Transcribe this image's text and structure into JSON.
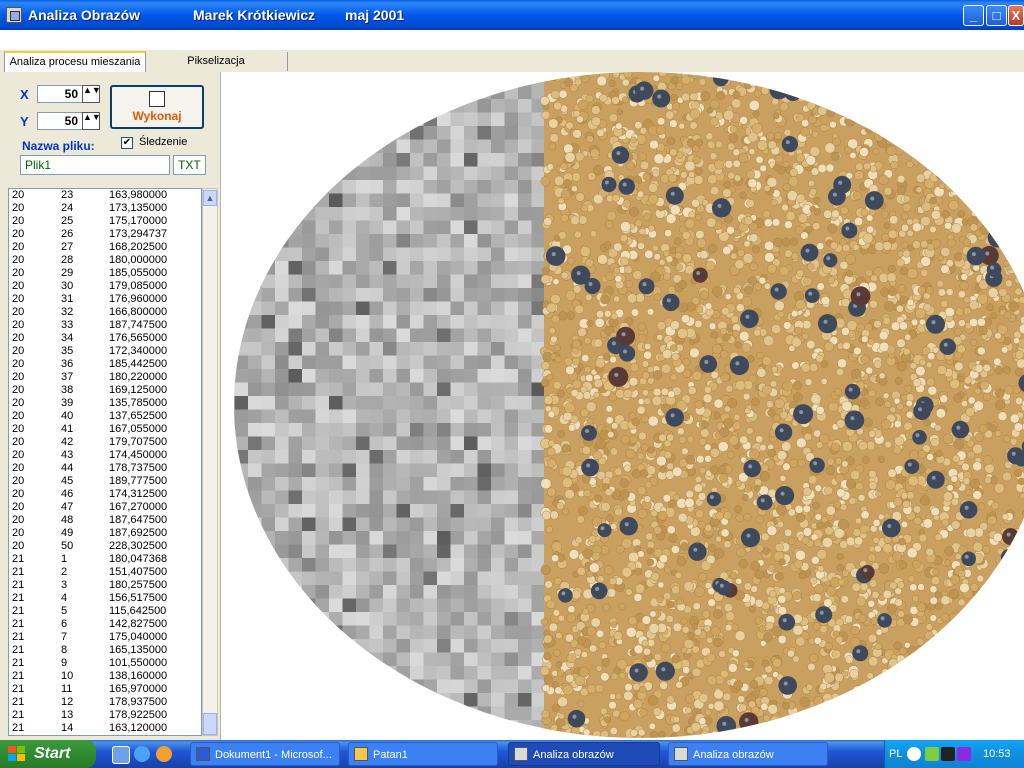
{
  "window": {
    "title": "Analiza Obrazów",
    "author": "Marek Krótkiewicz",
    "date": "maj 2001",
    "controls": {
      "minimize": "_",
      "maximize": "□",
      "close": "X"
    }
  },
  "tabs": [
    {
      "label": "Analiza procesu mieszania",
      "active": true
    },
    {
      "label": "Pikselizacja",
      "active": false
    }
  ],
  "controls": {
    "x_label": "X",
    "x_value": "50",
    "y_label": "Y",
    "y_value": "50",
    "execute_label": "Wykonaj",
    "tracking_label": "Śledzenie",
    "tracking_checked": true,
    "tracking_mark": "✔",
    "filename_label": "Nazwa pliku:",
    "filename_value": "Plik1",
    "extension_value": "TXT",
    "spin_arrows": "▲▼"
  },
  "data_rows": [
    [
      "20",
      "23",
      "163,980000"
    ],
    [
      "20",
      "24",
      "173,135000"
    ],
    [
      "20",
      "25",
      "175,170000"
    ],
    [
      "20",
      "26",
      "173,294737"
    ],
    [
      "20",
      "27",
      "168,202500"
    ],
    [
      "20",
      "28",
      "180,000000"
    ],
    [
      "20",
      "29",
      "185,055000"
    ],
    [
      "20",
      "30",
      "179,085000"
    ],
    [
      "20",
      "31",
      "176,960000"
    ],
    [
      "20",
      "32",
      "166,800000"
    ],
    [
      "20",
      "33",
      "187,747500"
    ],
    [
      "20",
      "34",
      "176,565000"
    ],
    [
      "20",
      "35",
      "172,340000"
    ],
    [
      "20",
      "36",
      "185,442500"
    ],
    [
      "20",
      "37",
      "180,220000"
    ],
    [
      "20",
      "38",
      "169,125000"
    ],
    [
      "20",
      "39",
      "135,785000"
    ],
    [
      "20",
      "40",
      "137,652500"
    ],
    [
      "20",
      "41",
      "167,055000"
    ],
    [
      "20",
      "42",
      "179,707500"
    ],
    [
      "20",
      "43",
      "174,450000"
    ],
    [
      "20",
      "44",
      "178,737500"
    ],
    [
      "20",
      "45",
      "189,777500"
    ],
    [
      "20",
      "46",
      "174,312500"
    ],
    [
      "20",
      "47",
      "167,270000"
    ],
    [
      "20",
      "48",
      "187,647500"
    ],
    [
      "20",
      "49",
      "187,692500"
    ],
    [
      "20",
      "50",
      "228,302500"
    ],
    [
      "21",
      "1",
      "180,047368"
    ],
    [
      "21",
      "2",
      "151,407500"
    ],
    [
      "21",
      "3",
      "180,257500"
    ],
    [
      "21",
      "4",
      "156,517500"
    ],
    [
      "21",
      "5",
      "115,642500"
    ],
    [
      "21",
      "6",
      "142,827500"
    ],
    [
      "21",
      "7",
      "175,040000"
    ],
    [
      "21",
      "8",
      "165,135000"
    ],
    [
      "21",
      "9",
      "101,550000"
    ],
    [
      "21",
      "10",
      "138,160000"
    ],
    [
      "21",
      "11",
      "165,970000"
    ],
    [
      "21",
      "12",
      "178,937500"
    ],
    [
      "21",
      "13",
      "178,922500"
    ],
    [
      "21",
      "14",
      "163,120000"
    ]
  ],
  "scroll": {
    "up": "▲"
  },
  "taskbar": {
    "start_label": "Start",
    "items": [
      {
        "label": "Dokument1 - Microsof...",
        "active": false
      },
      {
        "label": "Patan1",
        "active": false
      },
      {
        "label": "Analiza obrazów",
        "active": true
      },
      {
        "label": "Analiza obrazów",
        "active": false
      }
    ],
    "language": "PL",
    "clock": "10:53"
  },
  "colors": {
    "title_bar": "#0058E8",
    "label_blue": "#0033CC",
    "execute_text": "#E05A00",
    "filename_text": "#006600",
    "seed_yellow": "#D9B56A",
    "seed_dark": "#3E4A5C"
  },
  "icons": {
    "app": "app-icon",
    "execute": "document-icon",
    "start": "windows-logo-icon"
  }
}
